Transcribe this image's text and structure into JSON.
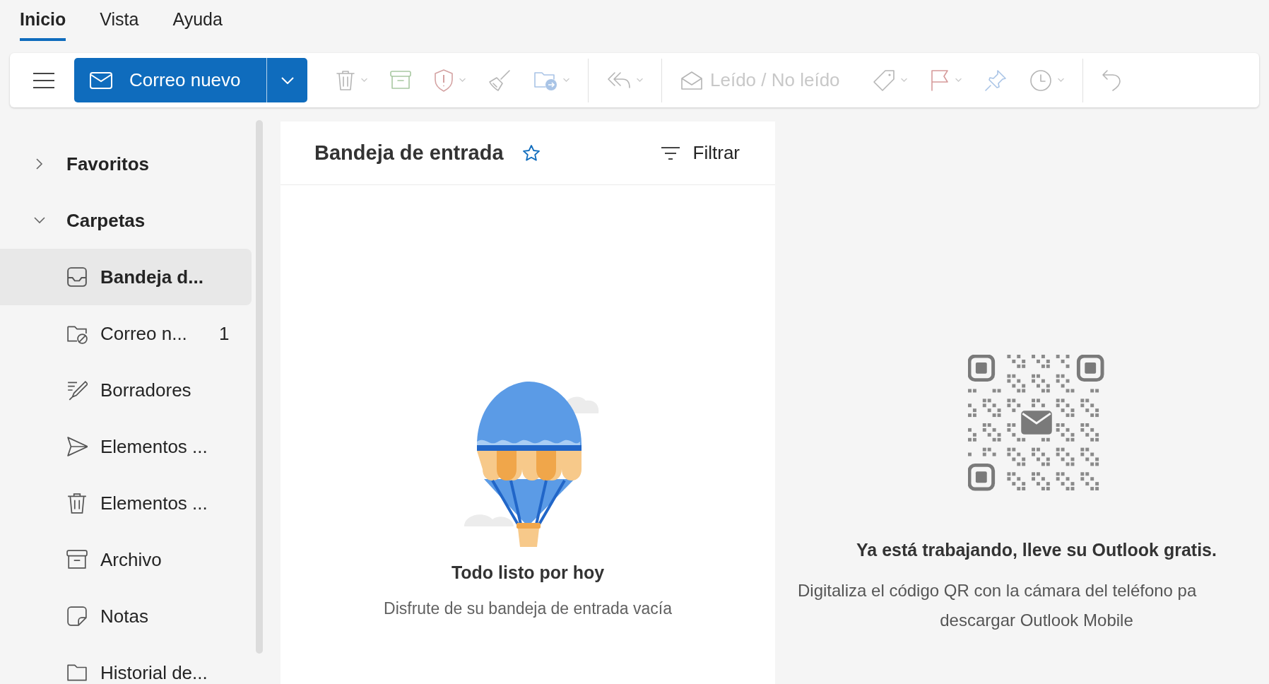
{
  "tabs": [
    {
      "label": "Inicio",
      "selected": true
    },
    {
      "label": "Vista",
      "selected": false
    },
    {
      "label": "Ayuda",
      "selected": false
    }
  ],
  "toolbar": {
    "new_mail": "Correo nuevo",
    "read_toggle": "Leído / No leído"
  },
  "sidebar": {
    "sections": [
      {
        "label": "Favoritos",
        "expanded": false
      },
      {
        "label": "Carpetas",
        "expanded": true,
        "children": [
          {
            "label": "Bandeja d...",
            "kind": "inbox",
            "selected": true
          },
          {
            "label": "Correo n...",
            "kind": "junk",
            "selected": false,
            "count": "1"
          },
          {
            "label": "Borradores",
            "kind": "drafts",
            "selected": false
          },
          {
            "label": "Elementos ...",
            "kind": "sent",
            "selected": false
          },
          {
            "label": "Elementos ...",
            "kind": "deleted",
            "selected": false
          },
          {
            "label": "Archivo",
            "kind": "archive",
            "selected": false
          },
          {
            "label": "Notas",
            "kind": "notes",
            "selected": false
          },
          {
            "label": "Historial de...",
            "kind": "folder",
            "selected": false
          }
        ]
      }
    ]
  },
  "mail_list": {
    "title": "Bandeja de entrada",
    "filter": "Filtrar",
    "empty_title": "Todo listo por hoy",
    "empty_text": "Disfrute de su bandeja de entrada vacía"
  },
  "reading_pane": {
    "heading": "Ya está trabajando, lleve su Outlook gratis.",
    "text_lines": [
      "Digitaliza el código QR con la cámara del teléfono pa",
      "descargar Outlook Mobile"
    ]
  }
}
